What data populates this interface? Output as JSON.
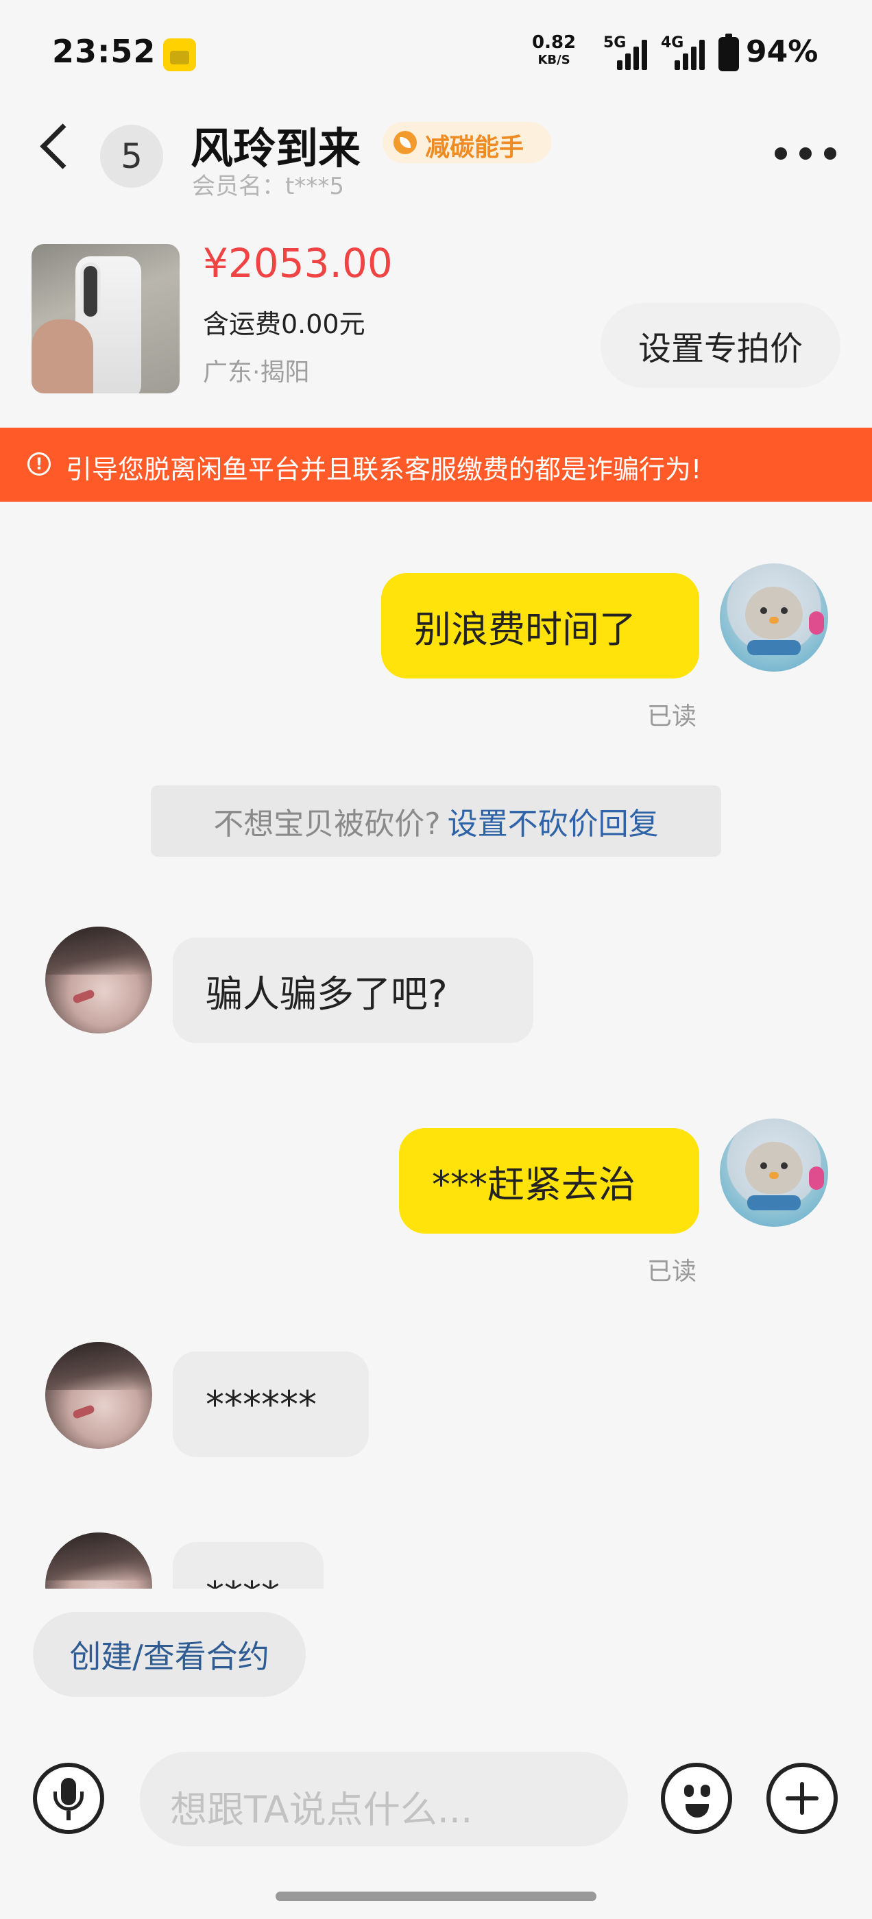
{
  "status_bar": {
    "time": "23:52",
    "net_speed": "0.82",
    "net_unit": "KB/S",
    "sig1": "5G",
    "sig2": "4G",
    "battery": "94%"
  },
  "header": {
    "unread_count": "5",
    "title": "风玲到来",
    "eco_badge": "减碳能手",
    "member": "会员名：t***5"
  },
  "product": {
    "price": "¥2053.00",
    "shipping": "含运费0.00元",
    "location": "广东·揭阳",
    "special_price_btn": "设置专拍价"
  },
  "warning": "引导您脱离闲鱼平台并且联系客服缴费的都是诈骗行为!",
  "messages": [
    {
      "side": "mine",
      "text": "别浪费时间了",
      "status": "已读"
    },
    {
      "side": "theirs",
      "text": "骗人骗多了吧?"
    },
    {
      "side": "mine",
      "text": "***赶紧去治",
      "status": "已读"
    },
    {
      "side": "theirs",
      "text": "******"
    },
    {
      "side": "theirs",
      "text": "****"
    }
  ],
  "system_tip": {
    "prefix": "不想宝贝被砍价?",
    "link": "设置不砍价回复"
  },
  "bottom": {
    "contract_btn": "创建/查看合约",
    "input_placeholder": "想跟TA说点什么..."
  },
  "icons": [
    "back-chevron-icon",
    "more-dots-icon",
    "eco-leaf-icon",
    "warning-icon",
    "mic-icon",
    "emoji-icon",
    "plus-icon"
  ],
  "colors": {
    "accent_red": "#f04444",
    "warning_bg": "#ff5a28",
    "bubble_mine": "#ffe30a",
    "link_blue": "#2e63a8"
  }
}
